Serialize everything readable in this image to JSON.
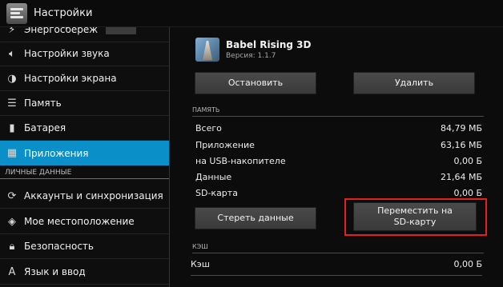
{
  "actionbar": {
    "title": "Настройки",
    "icon": "settings-sliders-icon"
  },
  "left": {
    "items": [
      {
        "label": "Энергосбереж",
        "icon": "power-save-icon",
        "partial": true
      },
      {
        "label": "Настройки звука",
        "icon": "speaker-icon"
      },
      {
        "label": "Настройки экрана",
        "icon": "brightness-icon"
      },
      {
        "label": "Память",
        "icon": "storage-icon"
      },
      {
        "label": "Батарея",
        "icon": "battery-icon"
      },
      {
        "label": "Приложения",
        "icon": "apps-icon",
        "selected": true
      },
      {
        "label": "Аккаунты и синхронизация",
        "icon": "sync-icon"
      },
      {
        "label": "Мое местоположение",
        "icon": "location-icon"
      },
      {
        "label": "Безопасность",
        "icon": "lock-icon"
      },
      {
        "label": "Язык и ввод",
        "icon": "language-icon"
      }
    ],
    "section_personal": "ЛИЧНЫЕ ДАННЫЕ"
  },
  "app": {
    "name": "Babel Rising 3D",
    "version": "Версия: 1.1.7",
    "stop_label": "Остановить",
    "delete_label": "Удалить"
  },
  "memory": {
    "header": "ПАМЯТЬ",
    "rows": [
      {
        "label": "Всего",
        "value": "84,79 МБ"
      },
      {
        "label": "Приложение",
        "value": "63,16 МБ"
      },
      {
        "label": "на USB-накопителе",
        "value": "0,00 Б"
      },
      {
        "label": "Данные",
        "value": "21,64 МБ"
      },
      {
        "label": "SD-карта",
        "value": "0,00 Б"
      }
    ],
    "clear_label": "Стереть данные",
    "move_label": "Переместить на SD-карту"
  },
  "cache": {
    "header": "КЭШ",
    "rows": [
      {
        "label": "Кэш",
        "value": "0,00 Б"
      }
    ]
  },
  "colors": {
    "accent": "#0a8fc8",
    "highlight": "#e2201e"
  }
}
